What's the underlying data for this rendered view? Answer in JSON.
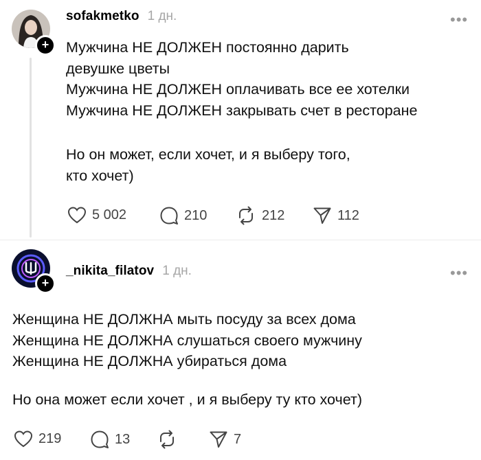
{
  "posts": [
    {
      "username": "sofakmetko",
      "time": "1 дн.",
      "text_lines": [
        "Мужчина НЕ ДОЛЖЕН постоянно дарить",
        "девушке цветы",
        "Мужчина НЕ ДОЛЖЕН оплачивать все ее хотелки",
        "Мужчина НЕ ДОЛЖЕН закрывать счет в ресторане",
        "Но он может, если хочет, и я выберу того,",
        "кто хочет)"
      ],
      "likes": "5 002",
      "comments": "210",
      "reposts": "212",
      "shares": "112"
    },
    {
      "username": "_nikita_filatov",
      "time": "1 дн.",
      "text_lines": [
        "Женщина НЕ ДОЛЖНА мыть посуду за всех дома",
        "Женщина НЕ ДОЛЖНА слушаться своего мужчину",
        "Женщина НЕ ДОЛЖНА убираться дома",
        "Но она может если хочет , и я выберу ту кто хочет)"
      ],
      "likes": "219",
      "comments": "13",
      "reposts": "",
      "shares": "7"
    }
  ],
  "icons": {
    "more": "more-icon",
    "follow": "plus-icon",
    "like": "heart-icon",
    "comment": "comment-icon",
    "repost": "repost-icon",
    "share": "share-icon"
  },
  "colors": {
    "text": "#111111",
    "muted": "#a6a6a6",
    "thread_line": "#e2e2e2",
    "plus_badge": "#000000"
  }
}
